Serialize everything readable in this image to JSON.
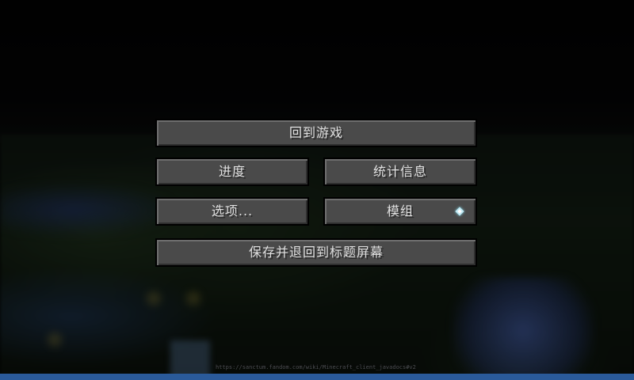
{
  "pause_menu": {
    "resume_label": "回到游戏",
    "progress_label": "进度",
    "stats_label": "统计信息",
    "options_label": "选项...",
    "mods_label": "模组",
    "mods_indicator_icon": "diamond-icon",
    "quit_label": "保存并退回到标题屏幕"
  },
  "background": {
    "debug_text": "https://sanctum.fandom.com/wiki/Minecraft_client_javadocs#v2"
  },
  "colors": {
    "button_fill": "#4a4a4a",
    "button_text": "#e0e0e0",
    "bottom_bar": "#2a5a9a",
    "indicator": "#bfe8f2"
  }
}
